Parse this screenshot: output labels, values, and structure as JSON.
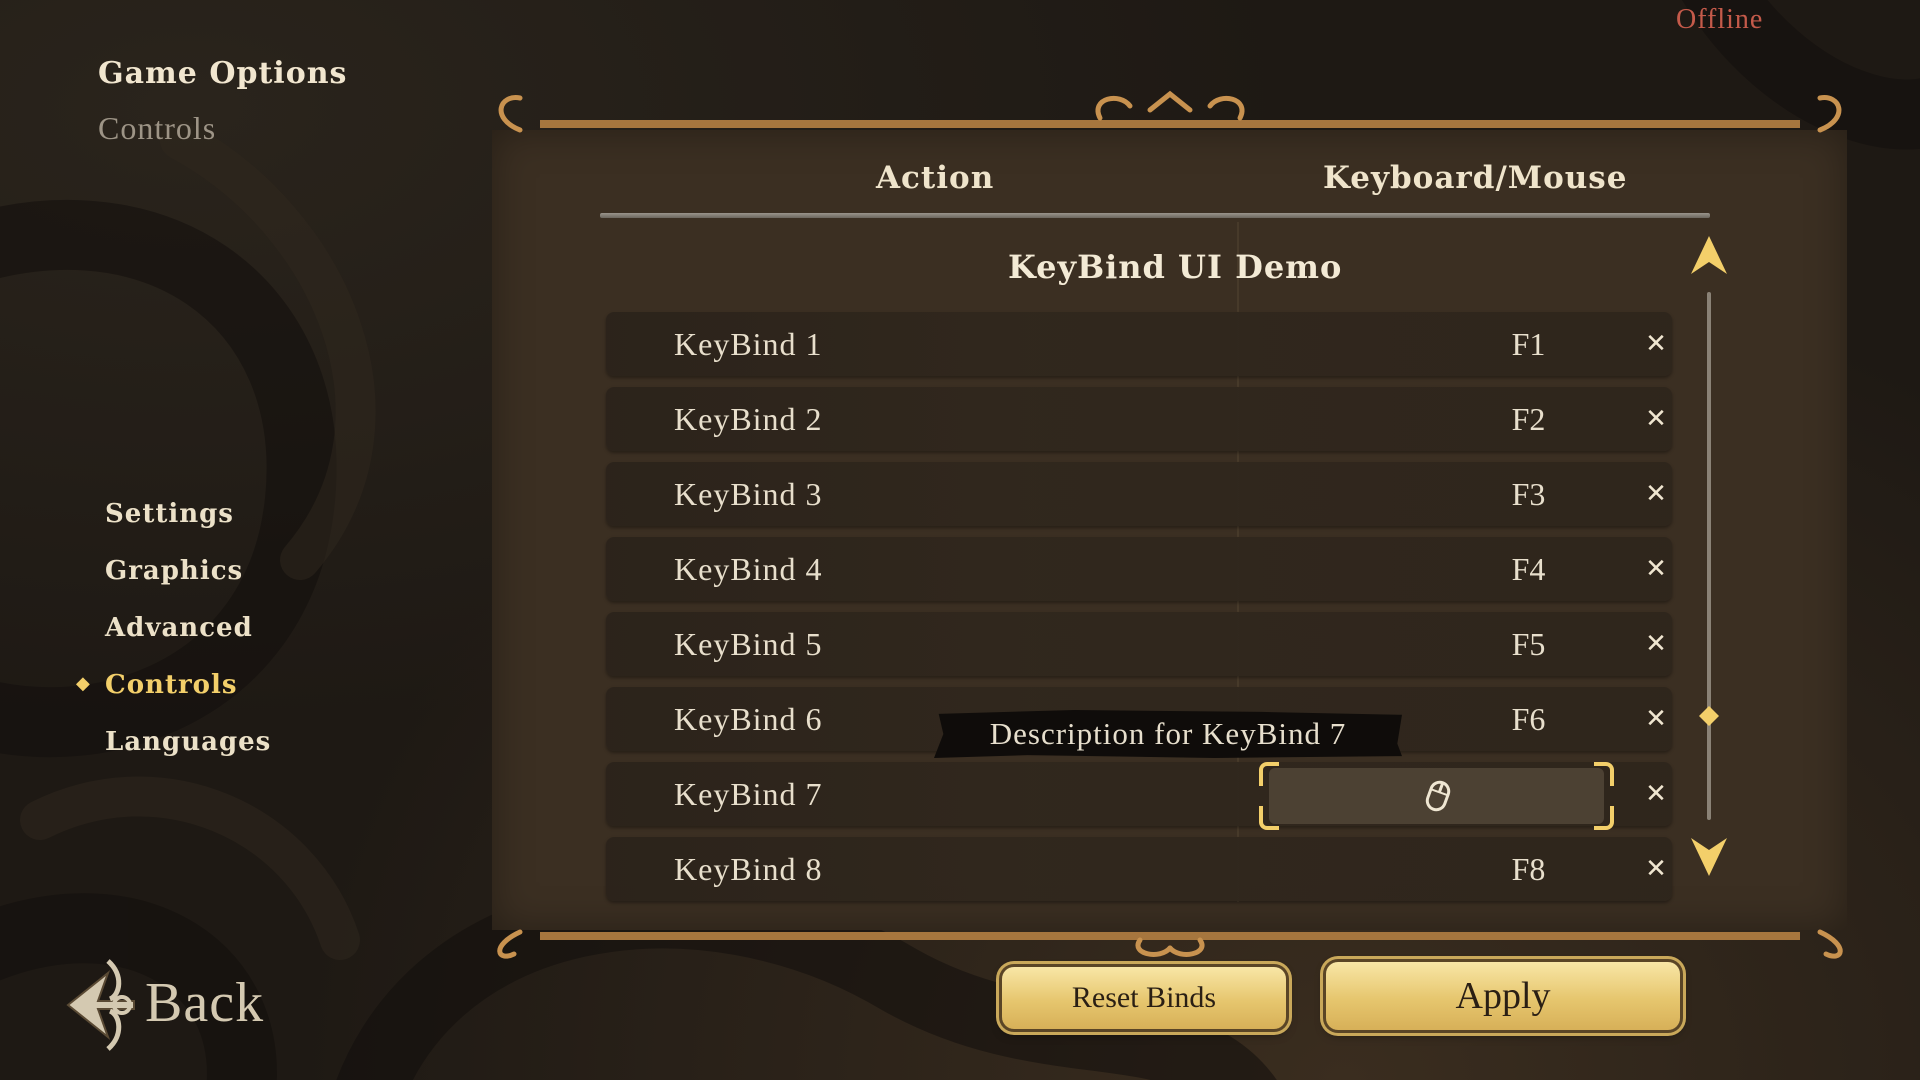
{
  "header": {
    "title": "Game Options",
    "breadcrumb": "Controls"
  },
  "status": {
    "label": "Offline",
    "color": "#c45a4a"
  },
  "side_menu": {
    "items": [
      {
        "label": "Settings",
        "active": false
      },
      {
        "label": "Graphics",
        "active": false
      },
      {
        "label": "Advanced",
        "active": false
      },
      {
        "label": "Controls",
        "active": true
      },
      {
        "label": "Languages",
        "active": false
      }
    ]
  },
  "back": {
    "label": "Back",
    "icon": "ornate-back-arrow-icon"
  },
  "table": {
    "columns": [
      "Action",
      "Keyboard/Mouse"
    ],
    "section_title": "KeyBind UI Demo",
    "rows": [
      {
        "action": "KeyBind 1",
        "key": "F1",
        "clear_icon": "close-icon"
      },
      {
        "action": "KeyBind 2",
        "key": "F2",
        "clear_icon": "close-icon"
      },
      {
        "action": "KeyBind 3",
        "key": "F3",
        "clear_icon": "close-icon"
      },
      {
        "action": "KeyBind 4",
        "key": "F4",
        "clear_icon": "close-icon"
      },
      {
        "action": "KeyBind 5",
        "key": "F5",
        "clear_icon": "close-icon"
      },
      {
        "action": "KeyBind 6",
        "key": "F6",
        "clear_icon": "close-icon"
      },
      {
        "action": "KeyBind 7",
        "key": "",
        "key_icon": "mouse-icon",
        "listening": true,
        "clear_icon": "close-icon"
      },
      {
        "action": "KeyBind 8",
        "key": "F8",
        "clear_icon": "close-icon"
      }
    ]
  },
  "tooltip": {
    "text": "Description for KeyBind 7"
  },
  "scrollbar": {
    "up_icon": "scroll-up-arrow-icon",
    "down_icon": "scroll-down-arrow-icon",
    "thumb_icon": "diamond-icon"
  },
  "buttons": {
    "reset": "Reset Binds",
    "apply": "Apply"
  },
  "colors": {
    "accent": "#f3cf6a",
    "panel": "#3b2f22",
    "text": "#e8dfcc"
  }
}
